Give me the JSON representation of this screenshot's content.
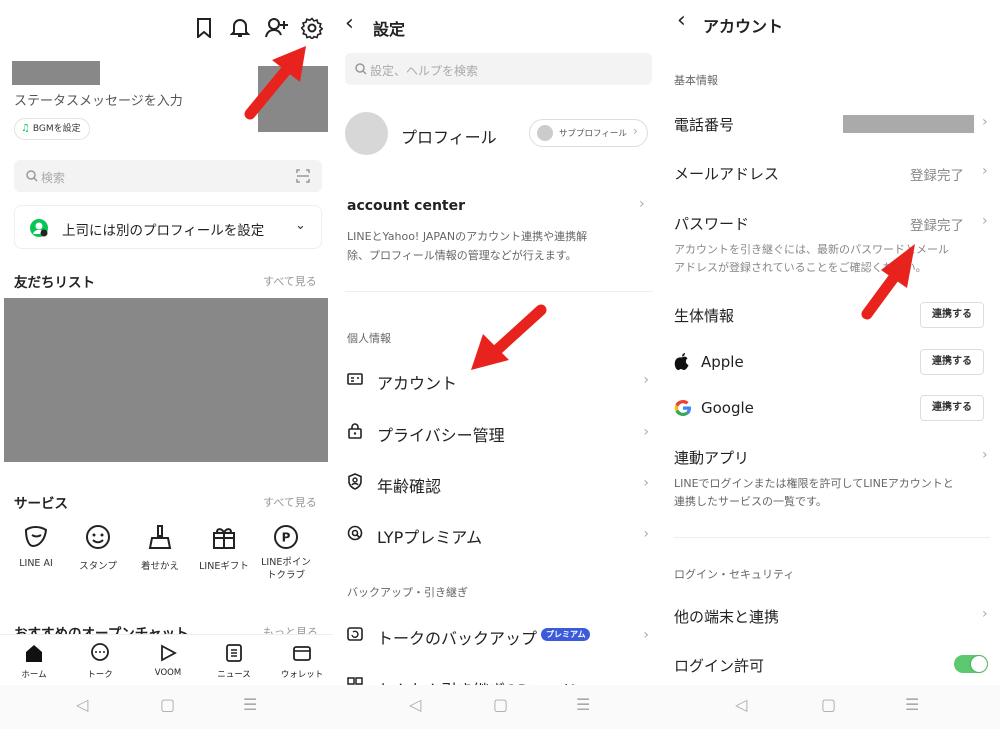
{
  "home": {
    "status_placeholder": "ステータスメッセージを入力",
    "bgm_label": "BGMを設定",
    "search_placeholder": "検索",
    "banner_text": "上司には別のプロフィールを設定",
    "friends_title": "友だちリスト",
    "friends_see_all": "すべて見る",
    "services_title": "サービス",
    "services_see_all": "すべて見る",
    "services": [
      {
        "label": "LINE AI",
        "icon": "line-ai-icon"
      },
      {
        "label": "スタンプ",
        "icon": "sticker-icon"
      },
      {
        "label": "着せかえ",
        "icon": "theme-icon"
      },
      {
        "label": "LINEギフト",
        "icon": "gift-icon"
      },
      {
        "label": "LINEポイン",
        "label2": "トクラブ",
        "icon": "points-icon"
      }
    ],
    "openchat_title": "おすすめのオープンチャット",
    "openchat_more": "もっと見る",
    "tabs": [
      {
        "label": "ホーム",
        "icon": "home-icon"
      },
      {
        "label": "トーク",
        "icon": "chat-icon"
      },
      {
        "label": "VOOM",
        "icon": "voom-icon"
      },
      {
        "label": "ニュース",
        "icon": "news-icon"
      },
      {
        "label": "ウォレット",
        "icon": "wallet-icon"
      }
    ]
  },
  "settings": {
    "title": "設定",
    "search_placeholder": "設定、ヘルプを検索",
    "profile_label": "プロフィール",
    "sub_profile_label": "サブプロフィール",
    "account_center_title": "account center",
    "account_center_desc1": "LINEとYahoo! JAPANのアカウント連携や連携解",
    "account_center_desc2": "除、プロフィール情報の管理などが行えます。",
    "personal_section": "個人情報",
    "items": [
      {
        "label": "アカウント"
      },
      {
        "label": "プライバシー管理"
      },
      {
        "label": "年齢確認"
      },
      {
        "label": "LYPプレミアム"
      }
    ],
    "backup_section": "バックアップ・引き継ぎ",
    "backup_item": "トークのバックアップ",
    "premium_badge": "プレミアム",
    "qr_item": "かんたん引き継ぎQRコード"
  },
  "account": {
    "title": "アカウント",
    "basic_section": "基本情報",
    "phone_label": "電話番号",
    "email_label": "メールアドレス",
    "email_status": "登録完了",
    "password_label": "パスワード",
    "password_status": "登録完了",
    "transfer_note1": "アカウントを引き継ぐには、最新のパスワードとメール",
    "transfer_note2": "アドレスが登録されていることをご確認ください。",
    "bio_label": "生体情報",
    "apple_label": "Apple",
    "google_label": "Google",
    "link_button": "連携する",
    "linked_apps_label": "連動アプリ",
    "linked_apps_desc1": "LINEでログインまたは権限を許可してLINEアカウントと",
    "linked_apps_desc2": "連携したサービスの一覧です。",
    "security_section": "ログイン・セキュリティ",
    "other_devices_label": "他の端末と連携",
    "login_permission_label": "ログイン許可",
    "login_permission_on": true
  },
  "colors": {
    "accent_red": "#e8231d",
    "line_green": "#06c755",
    "redacted_gray": "#888888",
    "premium_blue": "#3b5bdb"
  }
}
